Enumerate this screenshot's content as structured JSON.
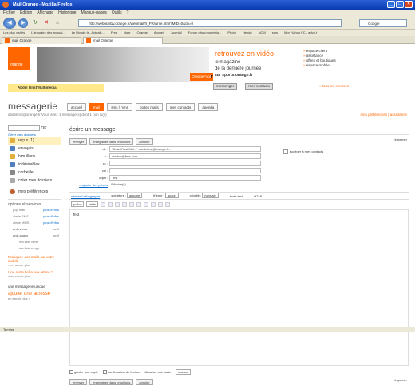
{
  "window": {
    "title": "Mail Orange - Mozilla Firefox"
  },
  "menu": [
    "Fichier",
    "Édition",
    "Affichage",
    "Historique",
    "Marque-pages",
    "Outils",
    "?"
  ],
  "nav": {
    "url": "http://webmail1v.orange.fr/webmail/fr_FR/write.html?MID=0&ch=0",
    "search_placeholder": "Google"
  },
  "bookmarks": [
    "Les plus visités",
    "L'annuaire des annuai...",
    "Le Monde.fr - Actualit...",
    "Free",
    "Note",
    "Orange",
    "Accueil",
    "Joomla!",
    "Forum photo numériq...",
    "Photo",
    "Hebdo",
    "NCM",
    "sms",
    "Mon Yahoo FC - advo.t"
  ],
  "tabs": [
    {
      "label": "mail Orange"
    },
    {
      "label": "mail Orange"
    }
  ],
  "banner": {
    "logo": "orange",
    "channel": "OrangeFoot",
    "channel_suffix": "TV",
    "headline": "retrouvez en vidéo",
    "line2": "le magazine",
    "line3": "de la dernière journée",
    "line4": "sur sports.orange.fr",
    "btn1": "messenger",
    "btn2": "mes contacts",
    "side_links": [
      "espace client",
      "assistance",
      "offres et boutiques",
      "espace mobile"
    ],
    "more_link": "» tous les services",
    "promo": "Abdel l'Inst'Multimédia"
  },
  "app": {
    "title": "messagerie",
    "tabs": [
      {
        "label": "accueil"
      },
      {
        "label": "mail"
      },
      {
        "label": "sms / mms"
      },
      {
        "label": "boites mails"
      },
      {
        "label": "mes contacts"
      },
      {
        "label": "agenda"
      }
    ],
    "account": "abdelinst@orange.fr  Vous avez 1 message(s) dont 1 non lu(s)",
    "prefs_link": "mes préférences  |  assistance"
  },
  "left": {
    "search_btn": "OK",
    "manage": "Gérer mes dossiers",
    "folders": [
      {
        "label": "reçus (1)"
      },
      {
        "label": "envoyés"
      },
      {
        "label": "brouillons"
      },
      {
        "label": "indésirables"
      },
      {
        "label": "corbeille"
      },
      {
        "label": "créer mes dossiers"
      }
    ],
    "prefs": "mes préférences",
    "options_title": "options et services",
    "options": [
      {
        "label": "pop mail",
        "action": "plus d'infos"
      },
      {
        "label": "alerte SMS",
        "action": "plus d'infos"
      },
      {
        "label": "alerte MMS",
        "action": "plus d'infos"
      },
      {
        "label": "anti-virus",
        "action": "actif"
      },
      {
        "label": "anti-spam",
        "action": "actif"
      },
      {
        "label": "ma liste verte",
        "action": ""
      },
      {
        "label": "ma liste rouge",
        "action": ""
      }
    ],
    "promo1": "Pratique : vos mails sur votre mobile",
    "promo1_sub": "» en savoir plus",
    "promo2": "Une autre boîte aux lettres ?",
    "promo2_sub": "» en savoir plus",
    "promo3": "une messagerie unique",
    "promo4": "ajouter une adresse",
    "promo4_sub": "en savoir plus »"
  },
  "compose": {
    "title": "écrire un message",
    "btn_send": "envoyer",
    "btn_draft": "enregistrer dans brouillons",
    "btn_cancel": "annuler",
    "print": "imprimer",
    "from_label": "de :",
    "from_value": "'Abdel l'Inst Mul...' <abdelinst@orange.fr>",
    "to_label": "à :",
    "to_value": "abcline@free.com",
    "cc_label": "cc :",
    "bcc_label": "cci :",
    "subject_label": "objet :",
    "subject_value": "Test",
    "attach_label": "» ajouter des pièces",
    "attach_value": "0 fichier(s)",
    "addrbook": "accéder à mes contacts",
    "fmt_link": "vérifier l'orthographe",
    "sig_label": "signature :",
    "sig_value": "aucune",
    "theme_label": "thème :",
    "theme_value": "aucun",
    "prio_label": "priorité :",
    "prio_value": "normale",
    "text_mode": "texte brut",
    "html_mode": "HTML",
    "font_value": "police",
    "size_value": "taille",
    "body": "Test",
    "opt_copy": "garder une copie",
    "opt_receipt": "confirmation de lecture",
    "opt_card": "Attacher une carte",
    "opt_card_value": "aucune"
  },
  "status": "Terminé"
}
